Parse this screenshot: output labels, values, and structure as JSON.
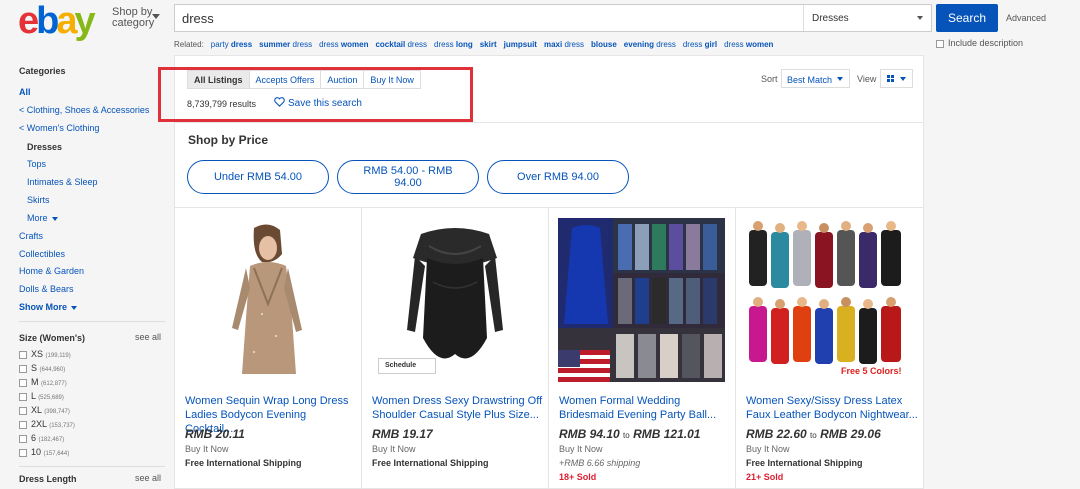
{
  "logo": {
    "letters": [
      "e",
      "b",
      "a",
      "y"
    ],
    "colors": [
      "#e53238",
      "#0064d2",
      "#f5af02",
      "#86b817"
    ]
  },
  "header": {
    "shop_by_line1": "Shop by",
    "shop_by_line2": "category",
    "search_value": "dress",
    "category": "Dresses",
    "search_button": "Search",
    "advanced": "Advanced",
    "include_description": "Include description",
    "related_label": "Related:",
    "related": [
      {
        "pre": "party ",
        "bold": "dress",
        "post": ""
      },
      {
        "pre": "",
        "bold": "summer",
        "post": " dress"
      },
      {
        "pre": "dress ",
        "bold": "women",
        "post": ""
      },
      {
        "pre": "",
        "bold": "cocktail",
        "post": " dress"
      },
      {
        "pre": "dress ",
        "bold": "long",
        "post": ""
      },
      {
        "pre": "",
        "bold": "skirt",
        "post": ""
      },
      {
        "pre": "",
        "bold": "jumpsuit",
        "post": ""
      },
      {
        "pre": "",
        "bold": "maxi",
        "post": " dress"
      },
      {
        "pre": "",
        "bold": "blouse",
        "post": ""
      },
      {
        "pre": "",
        "bold": "evening",
        "post": " dress"
      },
      {
        "pre": "dress ",
        "bold": "girl",
        "post": ""
      },
      {
        "pre": "dress ",
        "bold": "women",
        "post": ""
      }
    ]
  },
  "sidebar": {
    "categories_title": "Categories",
    "all": "All",
    "crumbs": [
      "< Clothing, Shoes & Accessories",
      "< Women's Clothing"
    ],
    "current": "Dresses",
    "sub": [
      "Tops",
      "Intimates & Sleep",
      "Skirts"
    ],
    "more": "More",
    "other": [
      "Crafts",
      "Collectibles",
      "Home & Garden",
      "Dolls & Bears"
    ],
    "show_more": "Show More",
    "size_title": "Size (Women's)",
    "see_all": "see all",
    "sizes": [
      {
        "label": "XS",
        "count": "(199,119)"
      },
      {
        "label": "S",
        "count": "(644,960)"
      },
      {
        "label": "M",
        "count": "(612,877)"
      },
      {
        "label": "L",
        "count": "(525,689)"
      },
      {
        "label": "XL",
        "count": "(398,747)"
      },
      {
        "label": "2XL",
        "count": "(153,737)"
      },
      {
        "label": "6",
        "count": "(182,467)"
      },
      {
        "label": "10",
        "count": "(157,644)"
      }
    ],
    "length_title": "Dress Length"
  },
  "main": {
    "tabs": [
      "All Listings",
      "Accepts Offers",
      "Auction",
      "Buy It Now"
    ],
    "results": "8,739,799 results",
    "save_search": "Save this search",
    "sort_label": "Sort",
    "sort_value": "Best Match",
    "view_label": "View",
    "shop_by_price": "Shop by Price",
    "price_ranges": [
      "Under RMB 54.00",
      "RMB 54.00 - RMB 94.00",
      "Over RMB 94.00"
    ]
  },
  "products": [
    {
      "title": "Women Sequin Wrap Long Dress Ladies Bodycon Evening Cocktail...",
      "price": "RMB 20.11",
      "price_to": "",
      "price_high": "",
      "format": "Buy It Now",
      "shipping": "Free International Shipping",
      "sold": ""
    },
    {
      "title": "Women Dress Sexy Drawstring Off Shoulder Casual Style Plus Size...",
      "price": "RMB 19.17",
      "price_to": "",
      "price_high": "",
      "format": "Buy It Now",
      "shipping": "Free International Shipping",
      "sold": "",
      "badge": "Schedule"
    },
    {
      "title": "Women Formal Wedding Bridesmaid Evening Party Ball...",
      "price": "RMB 94.10",
      "price_to": "to",
      "price_high": "RMB 121.01",
      "format": "Buy It Now",
      "shipping": "+RMB 6.66 shipping",
      "sold": "18+ Sold"
    },
    {
      "title": "Women Sexy/Sissy Dress Latex Faux Leather Bodycon Nightwear...",
      "price": "RMB 22.60",
      "price_to": "to",
      "price_high": "RMB 29.06",
      "format": "Buy It Now",
      "shipping": "Free International Shipping",
      "sold": "21+ Sold",
      "img_text": "Free 5 Colors!"
    }
  ]
}
